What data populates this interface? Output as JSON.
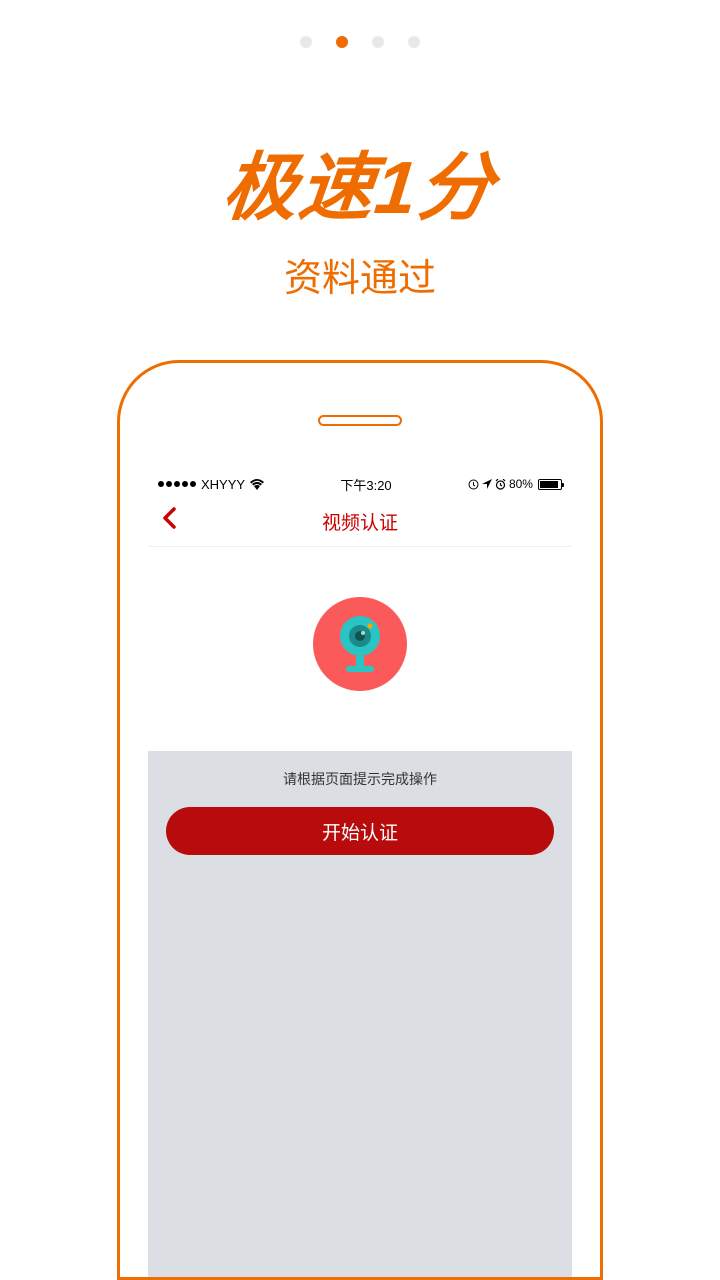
{
  "pageIndicator": {
    "total": 4,
    "active": 1
  },
  "headline": {
    "big": "极速1分",
    "sub": "资料通过"
  },
  "statusBar": {
    "carrier": "XHYYY",
    "time": "下午3:20",
    "battery": "80%"
  },
  "navBar": {
    "title": "视频认证"
  },
  "instruction": "请根据页面提示完成操作",
  "startButton": "开始认证"
}
